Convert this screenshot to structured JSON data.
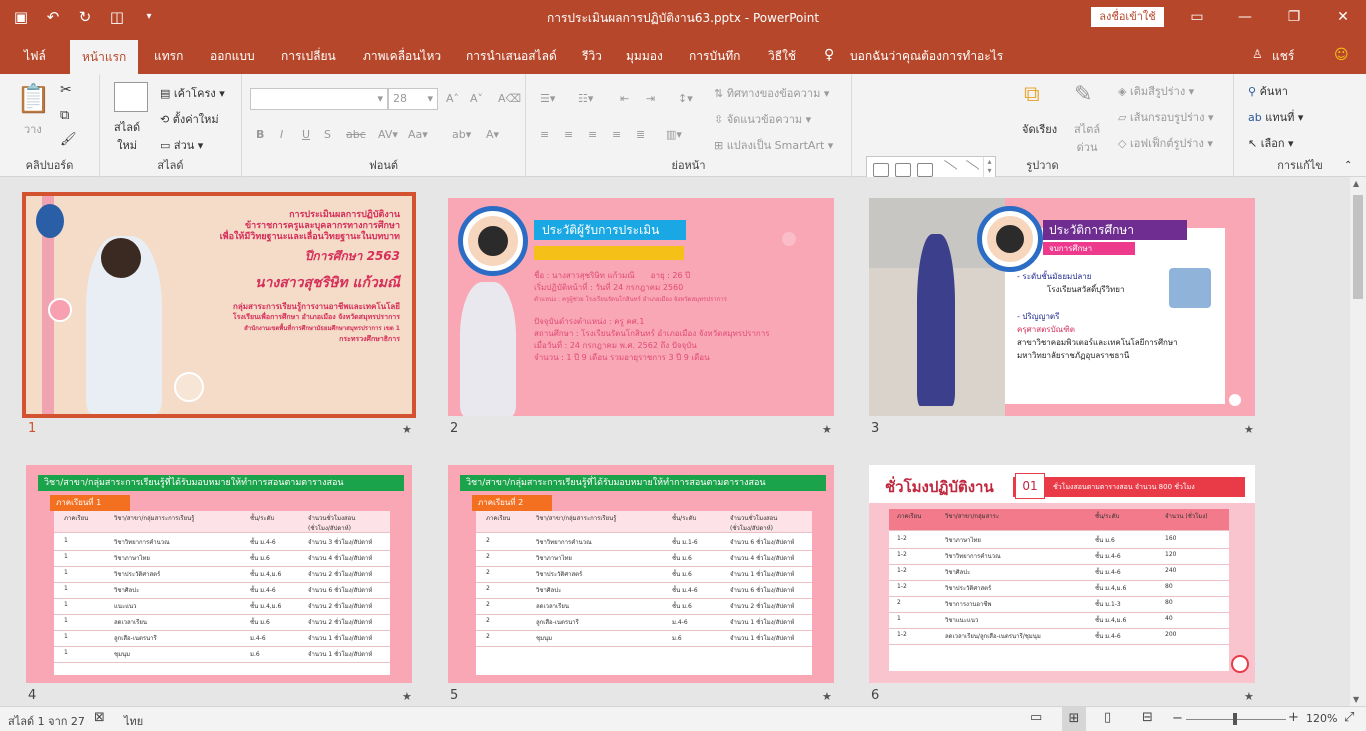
{
  "titlebar": {
    "document_title": "การประเมินผลการปฏิบัติงาน63.pptx  -  PowerPoint",
    "signin_label": "ลงชื่อเข้าใช้",
    "qat_icons": [
      "save-icon",
      "undo-icon",
      "redo-icon",
      "present-from-start-icon",
      "customize-qat-icon"
    ],
    "window_icons": [
      "ribbon-display-icon",
      "minimize-icon",
      "restore-icon",
      "close-icon"
    ]
  },
  "tabs": {
    "file": "ไฟล์",
    "items": [
      "หน้าแรก",
      "แทรก",
      "ออกแบบ",
      "การเปลี่ยน",
      "ภาพเคลื่อนไหว",
      "การนำเสนอสไลด์",
      "รีวิว",
      "มุมมอง",
      "การบันทึก",
      "วิธีใช้"
    ],
    "tell_me": "บอกฉันว่าคุณต้องการทำอะไร",
    "share": "แชร์"
  },
  "ribbon": {
    "clipboard": {
      "label": "คลิปบอร์ด",
      "paste": "วาง"
    },
    "slides": {
      "label": "สไลด์",
      "new_slide": "สไลด์\nใหม่",
      "layout": "เค้าโครง",
      "reset": "ตั้งค่าใหม่",
      "section": "ส่วน"
    },
    "font": {
      "label": "ฟอนต์",
      "size": "28"
    },
    "paragraph": {
      "label": "ย่อหน้า",
      "text_direction": "ทิศทางของข้อความ",
      "align_text": "จัดแนวข้อความ",
      "smartart": "แปลงเป็น SmartArt"
    },
    "drawing": {
      "label": "รูปวาด",
      "arrange": "จัดเรียง",
      "quick_styles": "สไตล์\nด่วน",
      "shape_fill": "เติมสีรูปร่าง",
      "shape_outline": "เส้นกรอบรูปร่าง",
      "shape_effects": "เอฟเฟ็กต์รูปร่าง"
    },
    "editing": {
      "label": "การแก้ไข",
      "find": "ค้นหา",
      "replace": "แทนที่",
      "select": "เลือก"
    }
  },
  "slides": [
    {
      "number": "1",
      "selected": true,
      "lines": [
        "การประเมินผลการปฏิบัติงาน",
        "ข้าราชการครูและบุคลากรทางการศึกษา",
        "เพื่อให้มีวิทยฐานะและเลื่อนวิทยฐานะในบทบาท",
        "ปีการศึกษา 2563",
        "นางสาวสุชริษิท แก้วมณี",
        "กลุ่มสาระการเรียนรู้การงานอาชีพและเทคโนโลยี",
        "โรงเรียนเพื่อการศึกษา อำเภอเมือง จังหวัดสมุทรปราการ",
        "สำนักงานเขตพื้นที่การศึกษามัธยมศึกษาสมุทรปราการ เขต 1",
        "กระทรวงศึกษาธิการ"
      ]
    },
    {
      "number": "2",
      "title": "ประวัติผู้รับการประเมิน",
      "lines": [
        "ชื่อ : นางสาวสุชริษิท  แก้วมณี",
        "อายุ : 26 ปี",
        "เริ่มปฏิบัติหน้าที่ : วันที่ 24 กรกฎาคม 2560",
        "ตำแหน่ง : ครูผู้ช่วย โรงเรียนรัตนโกสินทร์ อำเภอเมือง จังหวัดสมุทรปราการ",
        "ปัจจุบันดำรงตำแหน่ง : ครู คศ.1",
        "สถานศึกษา : โรงเรียนรัตนโกสินทร์ อำเภอเมือง จังหวัดสมุทรปราการ",
        "เมื่อวันที่ : 24 กรกฎาคม พ.ศ. 2562 ถึง ปัจจุบัน",
        "จำนวน : 1 ปี 9 เดือน  รวมอายุราชการ 3 ปี 9 เดือน"
      ]
    },
    {
      "number": "3",
      "title": "ประวัติการศึกษา",
      "subtitle": "จบการศึกษา",
      "lines": [
        "-  ระดับชั้นมัธยมปลาย",
        "โรงเรียนสวัสดิ์บุรีวิทยา",
        "-  ปริญญาตรี",
        "ครุศาสตรบัณฑิต",
        "สาขาวิชาคอมพิวเตอร์และเทคโนโลยีการศึกษา",
        "มหาวิทยาลัยราชภัฏอุบลราชธานี"
      ]
    },
    {
      "number": "4",
      "title": "วิชา/สาขา/กลุ่มสาระการเรียนรู้ที่ได้รับมอบหมายให้ทำการสอนตามตารางสอน",
      "term": "ภาคเรียนที่ 1",
      "headers": [
        "ภาคเรียน",
        "วิชา/สาขา/กลุ่มสาระการเรียนรู้",
        "ชั้น/ระดับ",
        "จำนวนชั่วโมงสอน (ชั่วโมง/สัปดาห์)"
      ],
      "rows": [
        [
          "1",
          "วิชาวิทยาการคำนวณ",
          "ชั้น ม.4-6",
          "จำนวน 3 ชั่วโมง/สัปดาห์"
        ],
        [
          "1",
          "วิชาภาษาไทย",
          "ชั้น ม.6",
          "จำนวน 4 ชั่วโมง/สัปดาห์"
        ],
        [
          "1",
          "วิชาประวัติศาสตร์",
          "ชั้น ม.4,ม.6",
          "จำนวน 2 ชั่วโมง/สัปดาห์"
        ],
        [
          "1",
          "วิชาศิลปะ",
          "ชั้น ม.4-6",
          "จำนวน 6 ชั่วโมง/สัปดาห์"
        ],
        [
          "1",
          "แนะแนว",
          "ชั้น ม.4,ม.6",
          "จำนวน 2 ชั่วโมง/สัปดาห์"
        ],
        [
          "1",
          "ลดเวลาเรียน",
          "ชั้น ม.6",
          "จำนวน 2 ชั่วโมง/สัปดาห์"
        ],
        [
          "1",
          "ลูกเสือ-เนตรนารี",
          "ม.4-6",
          "จำนวน 1 ชั่วโมง/สัปดาห์"
        ],
        [
          "1",
          "ชุมนุม",
          "ม.6",
          "จำนวน 1 ชั่วโมง/สัปดาห์"
        ]
      ]
    },
    {
      "number": "5",
      "title": "วิชา/สาขา/กลุ่มสาระการเรียนรู้ที่ได้รับมอบหมายให้ทำการสอนตามตารางสอน",
      "term": "ภาคเรียนที่ 2",
      "headers": [
        "ภาคเรียน",
        "วิชา/สาขา/กลุ่มสาระการเรียนรู้",
        "ชั้น/ระดับ",
        "จำนวนชั่วโมงสอน (ชั่วโมง/สัปดาห์)"
      ],
      "rows": [
        [
          "2",
          "วิชาวิทยาการคำนวณ",
          "ชั้น ม.1-6",
          "จำนวน 6 ชั่วโมง/สัปดาห์"
        ],
        [
          "2",
          "วิชาภาษาไทย",
          "ชั้น ม.6",
          "จำนวน 4 ชั่วโมง/สัปดาห์"
        ],
        [
          "2",
          "วิชาประวัติศาสตร์",
          "ชั้น ม.6",
          "จำนวน 1 ชั่วโมง/สัปดาห์"
        ],
        [
          "2",
          "วิชาศิลปะ",
          "ชั้น ม.4-6",
          "จำนวน 6 ชั่วโมง/สัปดาห์"
        ],
        [
          "2",
          "ลดเวลาเรียน",
          "ชั้น ม.6",
          "จำนวน 2 ชั่วโมง/สัปดาห์"
        ],
        [
          "2",
          "ลูกเสือ-เนตรนารี",
          "ม.4-6",
          "จำนวน 1 ชั่วโมง/สัปดาห์"
        ],
        [
          "2",
          "ชุมนุม",
          "ม.6",
          "จำนวน 1 ชั่วโมง/สัปดาห์"
        ]
      ]
    },
    {
      "number": "6",
      "title": "ชั่วโมงปฏิบัติงาน",
      "badge": "01",
      "banner": "ชั่วโมงสอนตามตารางสอน จำนวน  800  ชั่วโมง",
      "headers": [
        "ภาคเรียน",
        "วิชา/สาขา/กลุ่มสาระ",
        "ชั้น/ระดับ",
        "จำนวน (ชั่วโมง)"
      ],
      "rows": [
        [
          "1-2",
          "วิชาภาษาไทย",
          "ชั้น ม.6",
          "160"
        ],
        [
          "1-2",
          "วิชาวิทยาการคำนวณ",
          "ชั้น ม.4-6",
          "120"
        ],
        [
          "1-2",
          "วิชาศิลปะ",
          "ชั้น ม.4-6",
          "240"
        ],
        [
          "1-2",
          "วิชาประวัติศาสตร์",
          "ชั้น ม.4,ม.6",
          "80"
        ],
        [
          "2",
          "วิชาการงานอาชีพ",
          "ชั้น ม.1-3",
          "80"
        ],
        [
          "1",
          "วิชาแนะแนว",
          "ชั้น ม.4,ม.6",
          "40"
        ],
        [
          "1-2",
          "ลดเวลาเรียน/ลูกเสือ-เนตรนารี/ชุมนุม",
          "ชั้น ม.4-6",
          "200"
        ]
      ]
    }
  ],
  "status": {
    "slide_counter": "สไลด์ 1 จาก 27",
    "language": "ไทย",
    "zoom": "120%",
    "zoom_level_fraction": 0.49
  },
  "colors": {
    "accent": "#b7472a",
    "slide_pink": "#f9a7b5",
    "green_band": "#1aa34a",
    "orange_band": "#f37021",
    "red_banner": "#e83b47"
  }
}
